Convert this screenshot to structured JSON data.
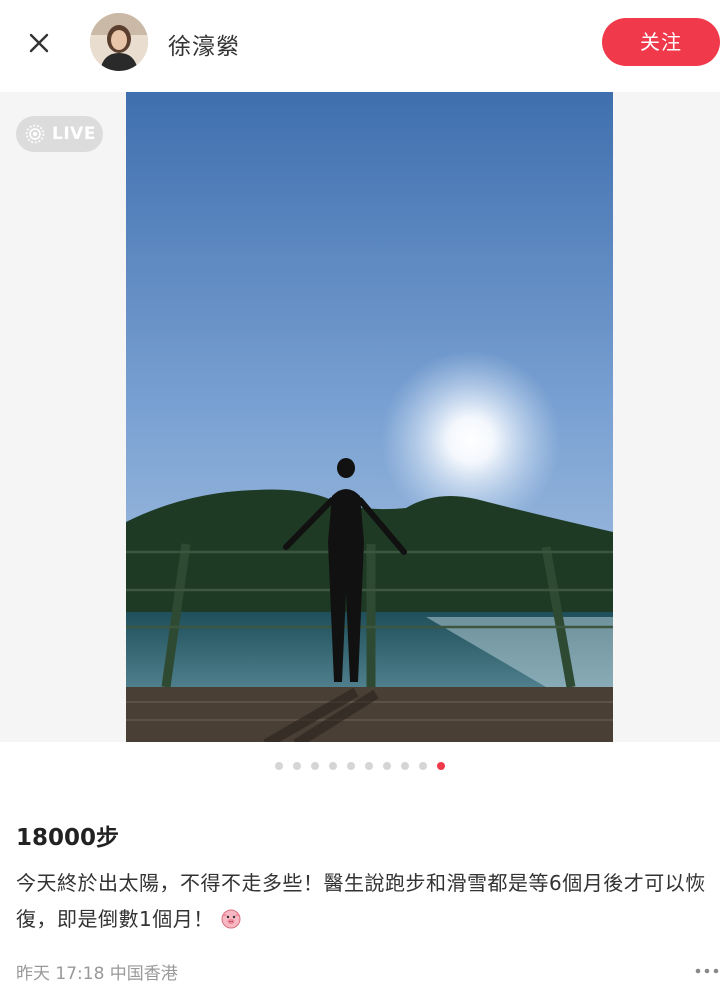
{
  "header": {
    "author_name": "徐濠縈",
    "follow_label": "关注",
    "close_icon": "close-icon",
    "avatar_alt": "avatar"
  },
  "carousel": {
    "live_label": "LIVE",
    "live_icon": "live-photo-icon",
    "total_images": 10,
    "active_index": 9,
    "accent_color": "#f0394b"
  },
  "post": {
    "title": "18000步",
    "body": "今天終於出太陽，不得不走多些！醫生說跑步和滑雪都是等6個月後才可以恢復，即是倒數1個月！",
    "emoji_icon": "pig-face-emoji",
    "meta": "昨天 17:18 中国香港",
    "more_icon": "more-dots-icon"
  }
}
